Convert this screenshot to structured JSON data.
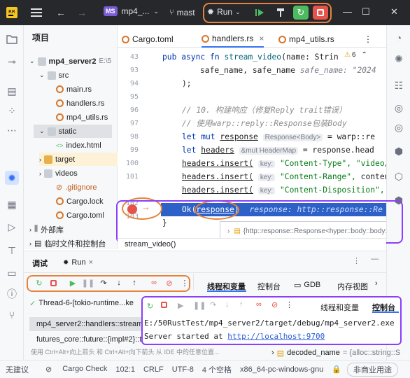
{
  "titlebar": {
    "project_badge": "MS",
    "project_name": "mp4_...",
    "branch": "mast",
    "run_label": "Run"
  },
  "project_panel": {
    "title": "项目",
    "root": "mp4_server2",
    "root_path": "E:\\5",
    "items": [
      {
        "label": "src",
        "type": "folder"
      },
      {
        "label": "main.rs",
        "type": "rs"
      },
      {
        "label": "handlers.rs",
        "type": "rs"
      },
      {
        "label": "mp4_utils.rs",
        "type": "rs"
      },
      {
        "label": "static",
        "type": "folder"
      },
      {
        "label": "index.html",
        "type": "html"
      },
      {
        "label": "target",
        "type": "folder"
      },
      {
        "label": "videos",
        "type": "folder"
      },
      {
        "label": ".gitignore",
        "type": "git"
      },
      {
        "label": "Cargo.lock",
        "type": "cargo"
      },
      {
        "label": "Cargo.toml",
        "type": "cargo"
      },
      {
        "label": "外部库",
        "type": "lib"
      },
      {
        "label": "临时文件和控制台",
        "type": "scratch"
      }
    ]
  },
  "tabs": [
    {
      "label": "Cargo.toml",
      "active": false
    },
    {
      "label": "handlers.rs",
      "active": true
    },
    {
      "label": "mp4_utils.rs",
      "active": false
    }
  ],
  "editor": {
    "line_numbers": [
      "43",
      "93",
      "94",
      "95",
      "96",
      "97",
      "98",
      "99",
      "100",
      "101",
      "102",
      "103"
    ],
    "warnings": "6",
    "lines": {
      "l43_kw1": "pub async fn",
      "l43_fn": "stream_video",
      "l43_rest": "(name: Strin",
      "l93_code": "safe_name, safe_name",
      "l93_hint": "safe_name: \"2024",
      "l94_code": ");",
      "l96_comment": "// 10. 构建响应（修复Reply trait错误）",
      "l97_comment": "// 使用warp::reply::Response包装Body",
      "l98_kw": "let mut",
      "l98_var": "response",
      "l98_hint": "Response<Body>",
      "l98_rest": "= warp::re",
      "l99_kw": "let",
      "l99_var": "headers",
      "l99_hint": "&mut HeaderMap",
      "l99_rest": "= response.head",
      "l100_a": "headers.insert(",
      "l100_hint": "key:",
      "l100_str": "\"Content-Type\", \"video/",
      "l101_a": "headers.insert(",
      "l101_hint": "key:",
      "l101_str": "\"Content-Range\",",
      "l101_rest": "conten",
      "l102_a": "headers.insert(",
      "l102_hint": "key:",
      "l102_str": "\"Content-Disposition\",",
      "l103_ok": "Ok(",
      "l103_var": "response",
      "l103_close": ")",
      "l103_inline": "response: http::response::Re",
      "l104": "}",
      "tooltip": "{http::response::Response<hyper::body::body::"
    }
  },
  "breadcrumb": "stream_video()",
  "debug": {
    "tab_debug": "调试",
    "tab_run": "Run",
    "subtabs": [
      "线程和变量",
      "控制台",
      "GDB",
      "内存视图"
    ],
    "frames": [
      "Thread-6-[tokio-runtime...ke",
      "mp4_server2::handlers::stream",
      "futures_core::future::{impl#2}::t"
    ],
    "hint": "使用 Ctrl+Alt+向上箭头 和 Ctrl+Alt+向下箭头 从 IDE 中的任意位置...",
    "variable_name": "decoded_name",
    "variable_value": "= {alloc::string::S",
    "overlay_subtabs": [
      "线程和变量",
      "控制台"
    ],
    "console_line1": "E:/50RustTest/mp4_server2/target/debug/mp4_server2.exe",
    "console_line2_prefix": "Server started at ",
    "console_link": "http://localhost:9700"
  },
  "statusbar": {
    "left": "无建议",
    "cargo": "Cargo Check",
    "position": "102:1",
    "line_sep": "CRLF",
    "encoding": "UTF-8",
    "indent": "4 个空格",
    "toolchain": "x86_64-pc-windows-gnu",
    "badge": "非商业用途"
  },
  "colors": {
    "titlebar": "#27282b",
    "annotation_orange": "#e8823a",
    "annotation_purple": "#8a3ffc",
    "green": "#4dbb5f",
    "red": "#e5534b"
  }
}
